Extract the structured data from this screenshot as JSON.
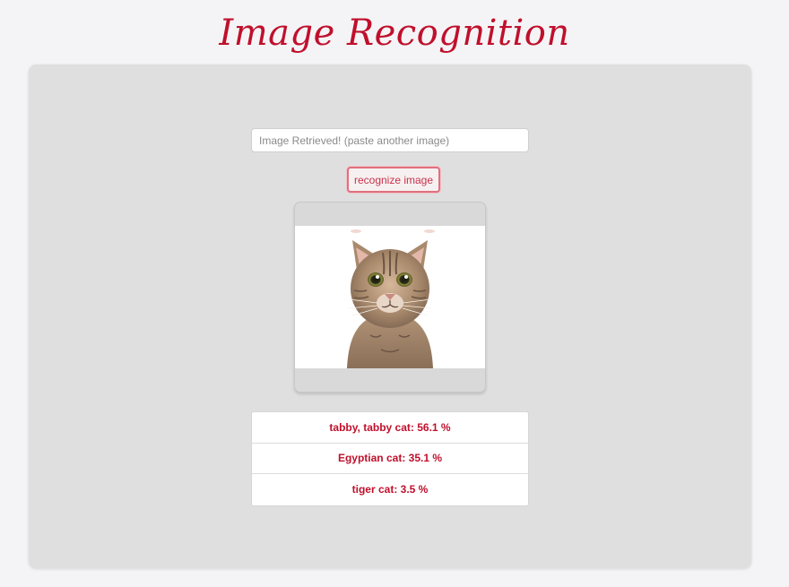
{
  "header": {
    "title": "Image Recognition"
  },
  "form": {
    "input_value": "",
    "input_placeholder": "Image Retrieved! (paste another image)",
    "recognize_label": "recognize image"
  },
  "preview": {
    "image_subject": "cat"
  },
  "predictions": [
    {
      "text": "tabby, tabby cat: 56.1 %"
    },
    {
      "text": "Egyptian cat: 35.1 %"
    },
    {
      "text": "tiger cat: 3.5 %"
    }
  ],
  "colors": {
    "accent": "#c0102c",
    "panel_background": "#dfdfdf",
    "page_background": "#f4f4f6",
    "button_border": "#e0707d"
  }
}
